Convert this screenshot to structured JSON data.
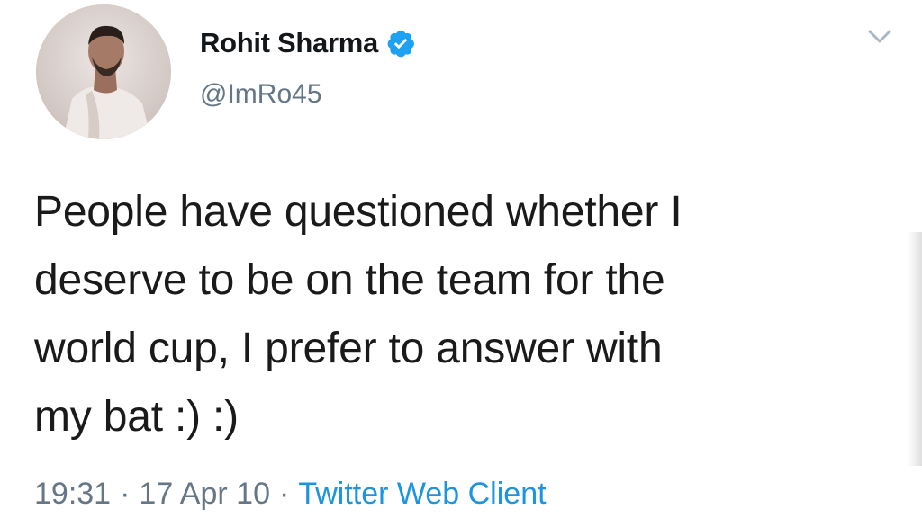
{
  "tweet": {
    "author": {
      "display_name": "Rohit Sharma",
      "handle": "@ImRo45",
      "verified": true
    },
    "text_lines": [
      "People have questioned whether I",
      "deserve to be on the team for the",
      "world cup, I prefer to answer with",
      "my bat :) :)"
    ],
    "meta": {
      "time": "19:31",
      "separator": "·",
      "date": "17 Apr 10",
      "client": "Twitter Web Client"
    }
  },
  "colors": {
    "verified_badge": "#1da1f2",
    "link": "#1b95e0",
    "secondary_text": "#657786"
  },
  "icons": {
    "verified": "verified-badge-icon",
    "caret": "chevron-down-icon"
  }
}
